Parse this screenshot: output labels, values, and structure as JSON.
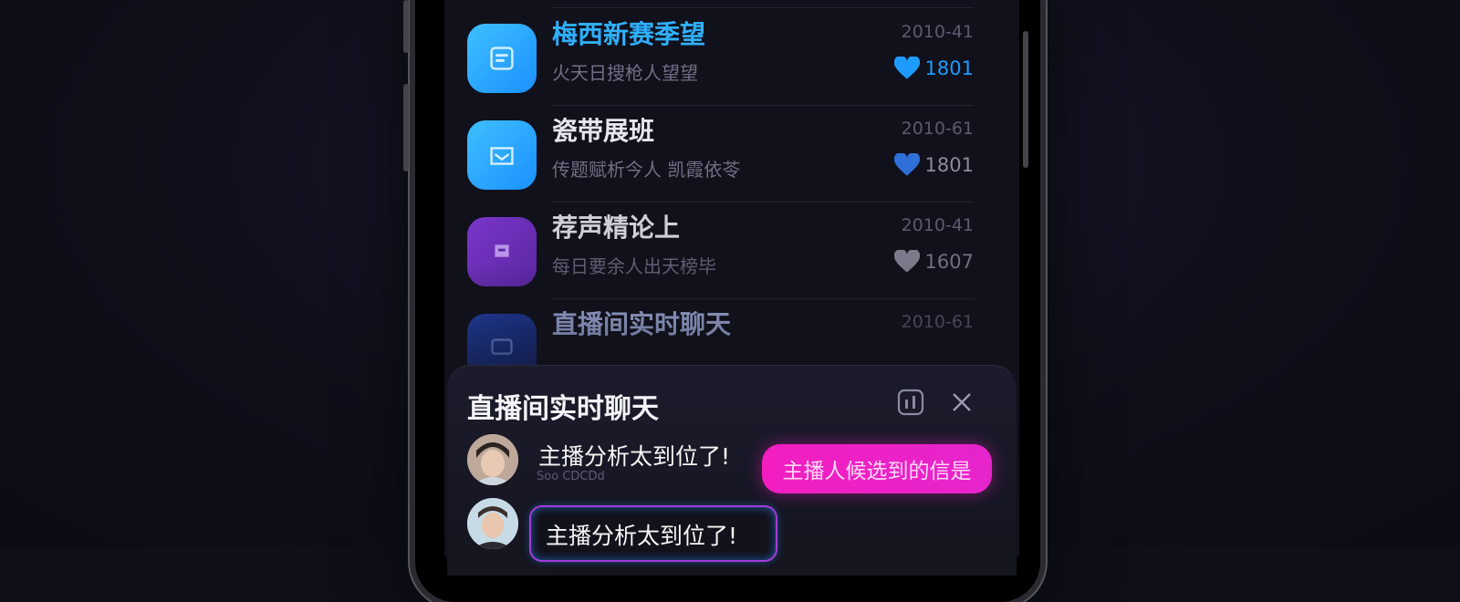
{
  "list": {
    "items": [
      {
        "title": "梅西新赛季望",
        "subtitle": "火天日搜枪人望望",
        "date": "2010-41",
        "likes": "1801",
        "icon": "news-icon",
        "color": "#25a8ff",
        "title_color": "#2fb0ff",
        "heart_color": "#1e9bff",
        "likes_color": "#1e9bff"
      },
      {
        "title": "瓷带展班",
        "subtitle": "传题赋析今人 凯霞依苓",
        "date": "2010-61",
        "likes": "1801",
        "icon": "inbox-icon",
        "color": "#25a8ff",
        "title_color": "#d9d9e3",
        "heart_color": "#2e6fd8",
        "likes_color": "#8b8ba0"
      },
      {
        "title": "荐声精论上",
        "subtitle": "每日要余人出天榜毕",
        "date": "2010-41",
        "likes": "1607",
        "icon": "cup-icon",
        "color": "#6a2fb6",
        "title_color": "#cfcfda",
        "heart_color": "#7a7a8a",
        "likes_color": "#6f6f84"
      },
      {
        "title": "直播间实时聊天",
        "subtitle": "",
        "date": "2010-61",
        "likes": "",
        "icon": "chat-icon",
        "color": "#1b3a9c",
        "title_color": "#a8b6e6",
        "heart_color": "",
        "likes_color": ""
      }
    ]
  },
  "chat": {
    "title": "直播间实时聊天",
    "messages": [
      {
        "text": "主播分析太到位了!",
        "username": "Soo CDCDd"
      },
      {
        "text": "主播分析太到位了!"
      }
    ],
    "highlight": "主播人候选到的信是"
  }
}
